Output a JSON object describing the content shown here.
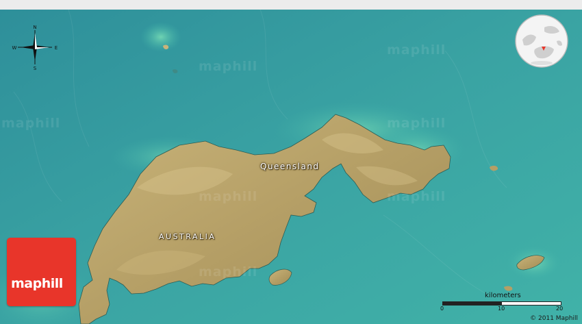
{
  "map": {
    "labels": {
      "country": "AUSTRALIA",
      "region": "Queensland"
    },
    "watermark_text": "maphill",
    "compass": {
      "north": "N",
      "south": "S",
      "east": "E",
      "west": "W"
    },
    "scale": {
      "title": "kilometers",
      "ticks": [
        "0",
        "10",
        "20"
      ]
    },
    "copyright": "© 2011 Maphill",
    "colors": {
      "water": "#3aa3a3",
      "shallow_water": "#4fc4a8",
      "land": "#b9a46a",
      "land_light": "#d8c38c",
      "logo": "#e8352a"
    }
  },
  "logo": {
    "text": "maphill"
  },
  "icons": [
    "compass-icon",
    "globe-locator-icon"
  ]
}
